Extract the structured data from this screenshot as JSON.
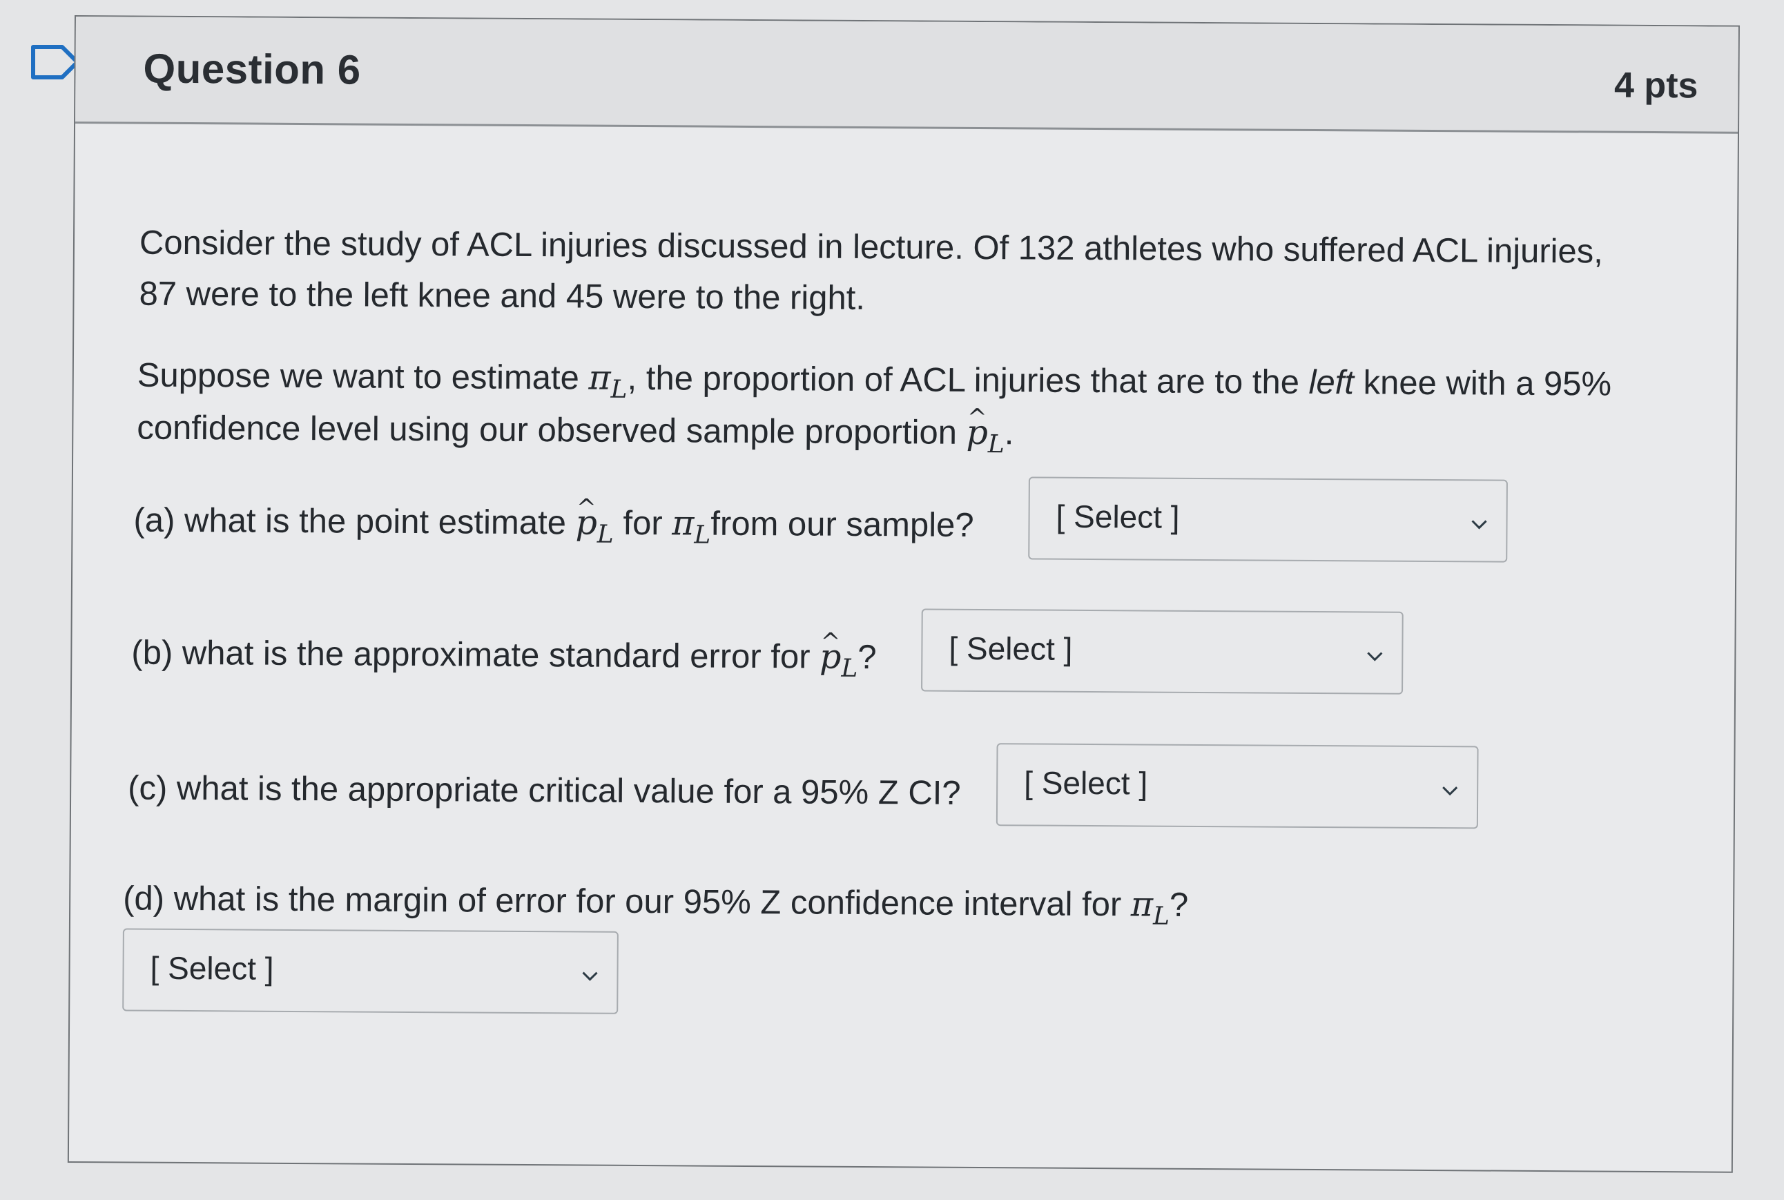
{
  "question": {
    "title": "Question 6",
    "points": "4 pts"
  },
  "paragraph1": {
    "line1": "Consider the study of ACL injuries discussed in lecture.  Of 132 athletes who suffered ACL injuries,",
    "line2": "87 were to the left knee and 45 were to the right."
  },
  "paragraph2": {
    "l1_a": "Suppose we want to estimate ",
    "pi": "π",
    "sub_L": "L",
    "l1_b": ", the proportion of ACL injuries that are to the ",
    "l1_italic": "left",
    "l1_c": " knee with a 95%",
    "l2_a": "confidence level using our observed sample proportion ",
    "p": "p",
    "l2_b": "."
  },
  "parts": {
    "a": {
      "t1": "(a) what is the point estimate ",
      "t2": " for ",
      "t3": "from our sample?",
      "select": "[ Select ]"
    },
    "b": {
      "t1": "(b) what is the approximate standard error for ",
      "t2": "?",
      "select": "[ Select ]"
    },
    "c": {
      "t1": "(c) what is the appropriate critical value for a 95% Z CI?",
      "select": "[ Select ]"
    },
    "d": {
      "t1": "(d) what is the margin of error for our 95% Z confidence interval for ",
      "t2": "?",
      "select": "[ Select ]"
    }
  }
}
